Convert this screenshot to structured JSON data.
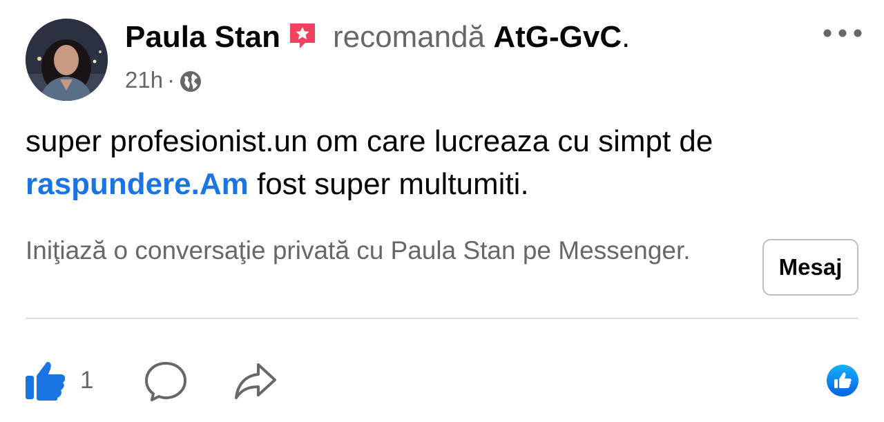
{
  "post": {
    "author": "Paula Stan",
    "recommends_text": "recomandă",
    "page_name": "AtG-GvC",
    "trailing_dot": ".",
    "time": "21h",
    "separator": "·",
    "audience_icon": "globe-icon",
    "text_line1": "super profesionist.un om care lucreaza cu simpt de",
    "text_link": "raspundere.Am",
    "text_line2_rest": " fost super multumiti."
  },
  "messenger": {
    "prompt": "Iniţiază o conversaţie privată cu Paula Stan pe Messenger.",
    "button_label": "Mesaj"
  },
  "actions": {
    "like_count": "1",
    "like_icon": "thumbs-up-icon",
    "comment_icon": "comment-icon",
    "share_icon": "share-icon",
    "reaction_icon": "like-reaction-icon"
  },
  "colors": {
    "link_blue": "#1b74e4",
    "secondary_text": "#65676b",
    "recommend_badge": "#f3425f",
    "divider": "#dadde1"
  }
}
